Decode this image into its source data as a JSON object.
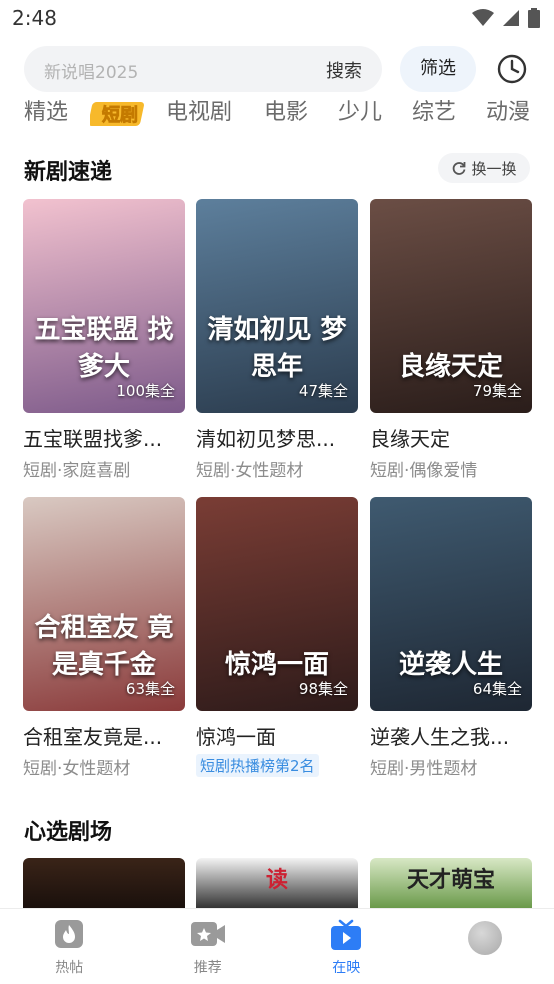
{
  "status": {
    "time": "2:48"
  },
  "search": {
    "placeholder": "新说唱2025",
    "button": "搜索",
    "filter": "筛选"
  },
  "channels": [
    "精选",
    "短剧",
    "电视剧",
    "电影",
    "少儿",
    "综艺",
    "动漫"
  ],
  "sections": {
    "new": {
      "title": "新剧速递",
      "refresh": "换一换"
    },
    "picks": {
      "title": "心选剧场"
    }
  },
  "cards": [
    {
      "title": "五宝联盟找爹...",
      "sub": "短剧·家庭喜剧",
      "episodes": "100集全",
      "art": "五宝联盟 找爹大",
      "color1": "#f2c2cf",
      "color2": "#7d5a8a"
    },
    {
      "title": "清如初见梦思...",
      "sub": "短剧·女性题材",
      "episodes": "47集全",
      "art": "清如初见 梦思年",
      "color1": "#5d7f9c",
      "color2": "#2b3c4e"
    },
    {
      "title": "良缘天定",
      "sub": "短剧·偶像爱情",
      "episodes": "79集全",
      "art": "良缘天定",
      "color1": "#6b4e45",
      "color2": "#2a1d1a"
    },
    {
      "title": "合租室友竟是...",
      "sub": "短剧·女性题材",
      "episodes": "63集全",
      "art": "合租室友 竟是真千金",
      "color1": "#d9c9c2",
      "color2": "#8a3a3a"
    },
    {
      "title": "惊鸿一面",
      "sub": "",
      "tag": "短剧热播榜第2名",
      "episodes": "98集全",
      "art": "惊鸿一面",
      "color1": "#7a3d35",
      "color2": "#2e1b1a"
    },
    {
      "title": "逆袭人生之我...",
      "sub": "短剧·男性题材",
      "episodes": "64集全",
      "art": "逆袭人生",
      "color1": "#3f5a70",
      "color2": "#1e2733"
    }
  ],
  "strip": [
    {
      "art": "",
      "color1": "#3a2418",
      "color2": "#1a100c"
    },
    {
      "art": "读",
      "color1": "#f4f4f4",
      "color2": "#333333"
    },
    {
      "art": "天才萌宝",
      "color1": "#d8e8c5",
      "color2": "#6a9a4a"
    }
  ],
  "nav": [
    {
      "label": "热帖",
      "icon": "flame-icon"
    },
    {
      "label": "推荐",
      "icon": "video-camera-icon"
    },
    {
      "label": "在映",
      "icon": "tv-play-icon"
    },
    {
      "label": "",
      "icon": "avatar"
    }
  ],
  "colors": {
    "accent": "#2d7df6",
    "tag": "#3a8de0"
  }
}
